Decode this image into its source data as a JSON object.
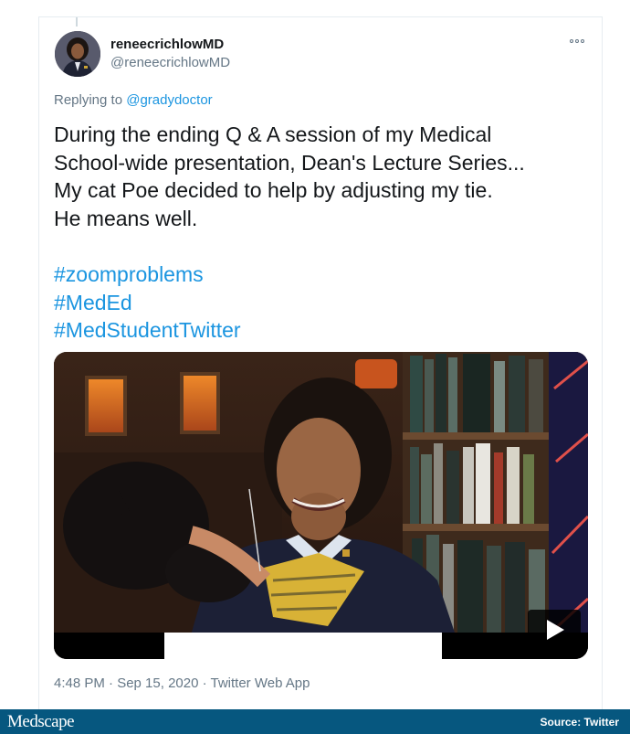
{
  "tweet": {
    "display_name": "reneecrichlowMD",
    "handle": "@reneecrichlowMD",
    "reply_prefix": "Replying to",
    "reply_to": "@gradydoctor",
    "text_lines": [
      "During the ending Q & A session of my Medical",
      "School-wide presentation, Dean's Lecture Series...",
      "My cat Poe decided to help by adjusting my tie.",
      "He means well."
    ],
    "hashtags": [
      "#zoomproblems",
      "#MedEd",
      "#MedStudentTwitter"
    ],
    "timestamp": "4:48 PM · Sep 15, 2020 · ",
    "source_app": "Twitter Web App"
  },
  "video": {
    "progress_fraction": 0.52
  },
  "footer": {
    "brand": "Medscape",
    "source": "Source: Twitter"
  },
  "colors": {
    "link": "#1b95e0",
    "footer_bg": "#06577f",
    "text": "#14171a",
    "muted": "#657786"
  },
  "icons": {
    "more": "more-icon",
    "play": "play-icon"
  }
}
